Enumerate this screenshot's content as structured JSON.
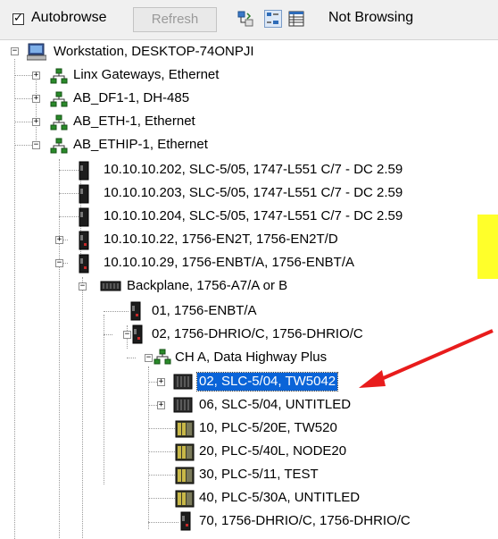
{
  "toolbar": {
    "autobrowse_label": "Autobrowse",
    "autobrowse_checked": true,
    "refresh_label": "Refresh",
    "status": "Not Browsing"
  },
  "tree": {
    "root": "Workstation, DESKTOP-74ONPJI",
    "drivers": [
      "Linx Gateways, Ethernet",
      "AB_DF1-1, DH-485",
      "AB_ETH-1, Ethernet",
      "AB_ETHIP-1, Ethernet"
    ],
    "ethip_nodes": [
      "10.10.10.202, SLC-5/05, 1747-L551 C/7 - DC 2.59",
      "10.10.10.203, SLC-5/05, 1747-L551 C/7 - DC 2.59",
      "10.10.10.204, SLC-5/05, 1747-L551 C/7 - DC 2.59",
      "10.10.10.22, 1756-EN2T, 1756-EN2T/D",
      "10.10.10.29, 1756-ENBT/A, 1756-ENBT/A"
    ],
    "backplane": "Backplane, 1756-A7/A or B",
    "slots": [
      "01, 1756-ENBT/A",
      "02, 1756-DHRIO/C,  1756-DHRIO/C"
    ],
    "channel": "CH A, Data Highway Plus",
    "dhplus_nodes": [
      "02, SLC-5/04, TW5042",
      "06, SLC-5/04, UNTITLED",
      "10, PLC-5/20E, TW520",
      "20, PLC-5/40L, NODE20",
      "30, PLC-5/11, TEST",
      "40, PLC-5/30A, UNTITLED",
      "70, 1756-DHRIO/C, 1756-DHRIO/C"
    ],
    "selected": "02, SLC-5/04, TW5042"
  },
  "colors": {
    "selection": "#0a64d8",
    "annotation_arrow": "#e81c1c",
    "highlight_box": "#ffff2a"
  }
}
